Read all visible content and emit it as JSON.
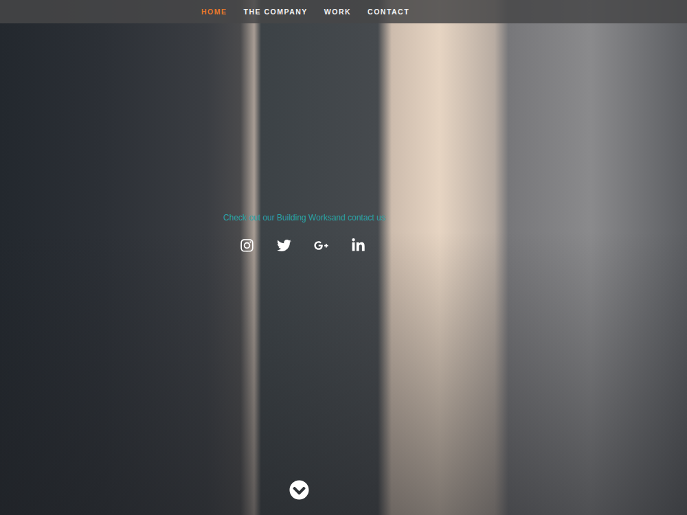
{
  "nav": {
    "items": [
      {
        "label": "HOME",
        "selected": true
      },
      {
        "label": "THE COMPANY",
        "selected": false
      },
      {
        "label": "WORK",
        "selected": false
      },
      {
        "label": "CONTACT",
        "selected": false
      }
    ]
  },
  "hero": {
    "tagline": "Check out our Building Worksand contact us"
  }
}
